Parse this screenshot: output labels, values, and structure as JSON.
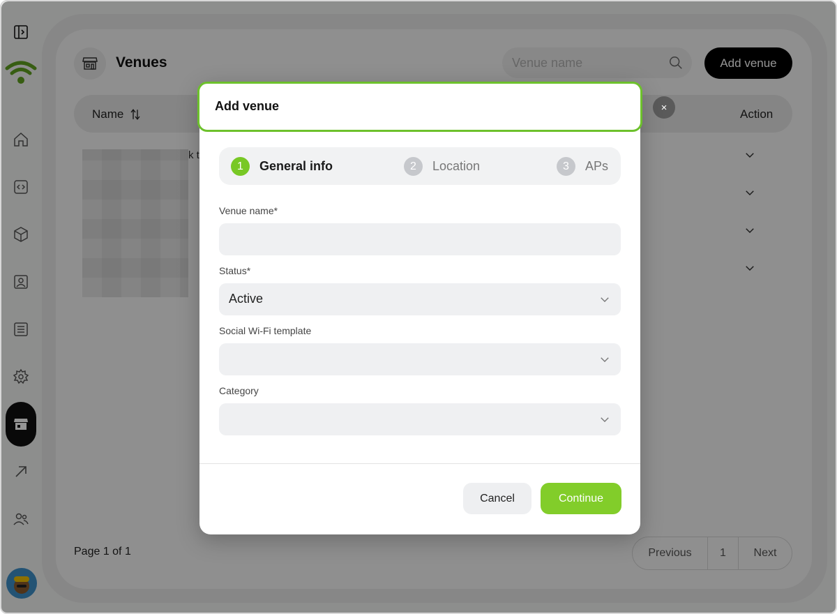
{
  "page": {
    "title": "Venues",
    "search_placeholder": "Venue name",
    "add_button": "Add venue",
    "table_headers": {
      "name": "Name",
      "action": "Action"
    },
    "row_fragment": "k t",
    "page_info": "Page 1 of 1",
    "pagination": {
      "previous": "Previous",
      "current": "1",
      "next": "Next"
    }
  },
  "sidebar": {
    "items": [
      "sidebar-toggle-icon",
      "home-icon",
      "code-icon",
      "box-icon",
      "contact-card-icon",
      "list-icon",
      "gear-icon",
      "store-icon",
      "arrow-up-right-icon",
      "users-icon"
    ],
    "active": "store-icon",
    "logo": "wifi-logo-icon"
  },
  "modal": {
    "title": "Add venue",
    "close": "×",
    "steps": [
      {
        "number": "1",
        "label": "General info",
        "active": true
      },
      {
        "number": "2",
        "label": "Location",
        "active": false
      },
      {
        "number": "3",
        "label": "APs",
        "active": false
      }
    ],
    "fields": {
      "venue_name": {
        "label": "Venue name*",
        "value": ""
      },
      "status": {
        "label": "Status*",
        "value": "Active"
      },
      "social_template": {
        "label": "Social Wi-Fi template",
        "value": ""
      },
      "category": {
        "label": "Category",
        "value": ""
      }
    },
    "cancel": "Cancel",
    "continue": "Continue"
  },
  "colors": {
    "accent": "#7ec52a",
    "dark": "#000000",
    "overlay": "rgba(0,0,0,0.42)"
  }
}
